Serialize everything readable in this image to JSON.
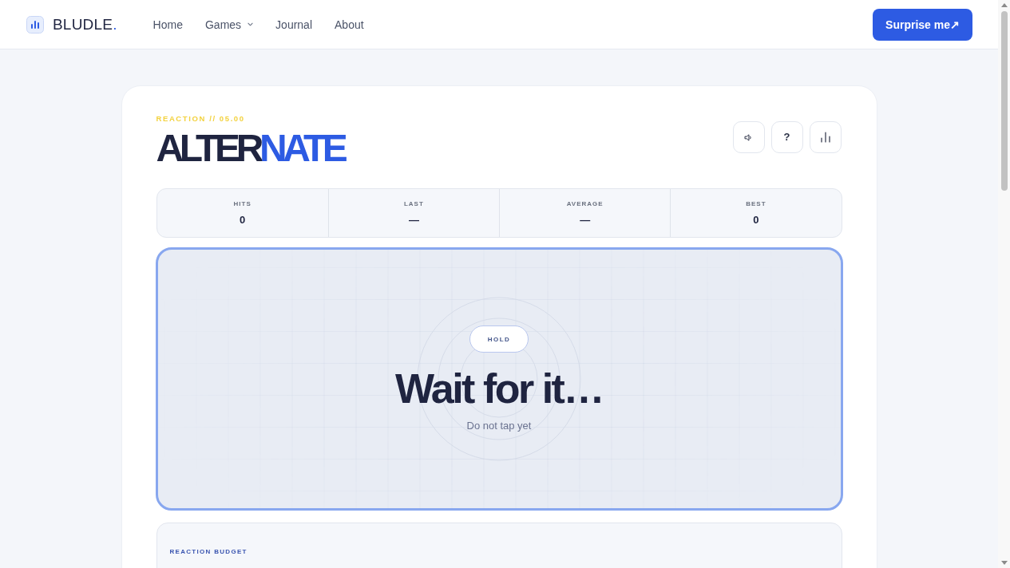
{
  "brand": {
    "parts": [
      {
        "text": "BLUDLE",
        "accent": false
      },
      {
        "text": ".",
        "accent": true
      }
    ]
  },
  "nav": [
    {
      "label": "Home",
      "has_menu": false
    },
    {
      "label": "Games",
      "has_menu": true
    },
    {
      "label": "Journal",
      "has_menu": false
    },
    {
      "label": "About",
      "has_menu": false
    }
  ],
  "cta": {
    "label": "Surprise me↗"
  },
  "game": {
    "eyebrow": "REACTION // 05.00",
    "title": [
      {
        "text": "ALTER",
        "accent": false
      },
      {
        "text": "NATE",
        "accent": true
      }
    ],
    "tools": [
      {
        "kind": "sound"
      },
      {
        "kind": "help",
        "label": "?"
      },
      {
        "kind": "stats"
      }
    ],
    "stats": [
      {
        "label": "HITS",
        "value": "0"
      },
      {
        "label": "LAST",
        "value": "—"
      },
      {
        "label": "AVERAGE",
        "value": "—"
      },
      {
        "label": "BEST",
        "value": "0"
      }
    ],
    "arena": {
      "badge": "HOLD",
      "message": "Wait for it…",
      "hint": "Do not tap yet"
    },
    "budget": {
      "title": "REACTION BUDGET"
    }
  }
}
